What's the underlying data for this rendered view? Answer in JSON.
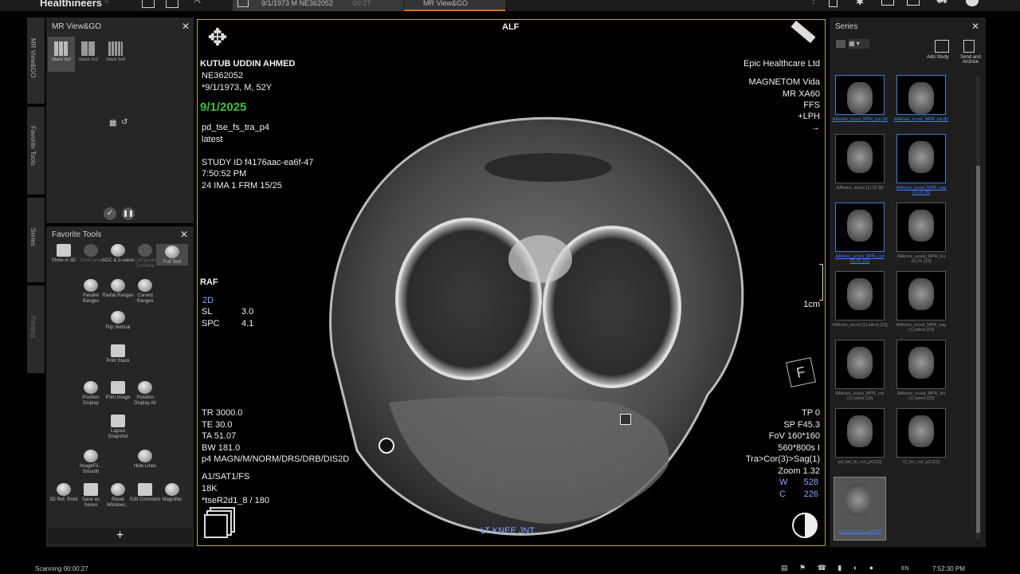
{
  "topbar": {
    "brand": "Healthineers",
    "tab1_label": "9/1/1973 M NE362052",
    "tab1_time": "00:27",
    "tab2_label": "MR View&GO"
  },
  "left_panel": {
    "title": "MR View&GO",
    "layouts": [
      "Stack 3x2",
      "Stack 2x2",
      "Stack 5x4"
    ]
  },
  "side_tabs": [
    "MR View&GO",
    "Favorite Tools",
    "Series",
    "Printing"
  ],
  "favorite_tools": {
    "title": "Favorite Tools",
    "tools": [
      {
        "id": "show3d",
        "label": "Show in 3D",
        "icon": "3d-icon"
      },
      {
        "id": "timecurve",
        "label": "TimeCurve",
        "icon": "timecurve-icon"
      },
      {
        "id": "adc",
        "label": "ADC & b-value",
        "icon": "adc-icon"
      },
      {
        "id": "compose",
        "label": "Compose/ Combine",
        "icon": "compose-icon"
      },
      {
        "id": "fulltext",
        "label": "Full Text",
        "icon": "fulltext-icon"
      },
      {
        "id": "parallel",
        "label": "Parallel Ranges",
        "icon": "parallel-ranges-icon"
      },
      {
        "id": "radial",
        "label": "Radial Ranges",
        "icon": "radial-ranges-icon"
      },
      {
        "id": "curved",
        "label": "Curved Ranges",
        "icon": "curved-ranges-icon"
      },
      {
        "id": "flip",
        "label": "Flip Vertical",
        "icon": "flip-vertical-icon"
      },
      {
        "id": "printstack",
        "label": "Print Stack",
        "icon": "print-stack-icon"
      },
      {
        "id": "posdisp",
        "label": "Position Display",
        "icon": "position-display-icon"
      },
      {
        "id": "printimg",
        "label": "Print Image",
        "icon": "print-image-icon"
      },
      {
        "id": "posdispall",
        "label": "Position Display All",
        "icon": "position-display-all-icon"
      },
      {
        "id": "layoutsnap",
        "label": "Layout Snapshot",
        "icon": "layout-snapshot-icon"
      },
      {
        "id": "imagefilter",
        "label": "ImageFil... Smooth",
        "icon": "image-filter-icon"
      },
      {
        "id": "hidelines",
        "label": "Hide Lines",
        "icon": "hide-lines-icon"
      },
      {
        "id": "ref3d",
        "label": "3D Ref. Point",
        "icon": "3d-ref-point-icon"
      },
      {
        "id": "saveseries",
        "label": "Save as Series",
        "icon": "save-series-icon"
      },
      {
        "id": "resetwin",
        "label": "Reset Windowi...",
        "icon": "reset-window-icon"
      },
      {
        "id": "editcomment",
        "label": "Edit Comment",
        "icon": "edit-comment-icon"
      },
      {
        "id": "magnifier",
        "label": "Magnifier",
        "icon": "magnifier-icon"
      }
    ]
  },
  "viewer": {
    "orient_top": "ALF",
    "orient_left": "RAF",
    "orient_bottom": "LT KNEE JNT.",
    "patient_name": "KUTUB UDDIN AHMED",
    "patient_id": "NE362052",
    "patient_dob": "*9/1/1973, M, 52Y",
    "study_date": "9/1/2025",
    "sequence": "pd_tse_fs_tra_p4",
    "sequence_sub": "latest",
    "study_id": "STUDY ID f4176aac-ea6f-47",
    "study_time": "7:50:52 PM",
    "image_info": "24 IMA 1 FRM 15/25",
    "mode": "2D",
    "sl_label": "SL",
    "sl_value": "3.0",
    "spc_label": "SPC",
    "spc_value": "4.1",
    "tr": "TR 3000.0",
    "te": "TE 30.0",
    "ta": "TA 51.07",
    "bw": "BW 181.0",
    "p4": "p4 MAGN/M/NORM/DRS/DRB/DIS2D",
    "coil": "A1/SAT1/FS",
    "k": "18K",
    "tser": "*tseR2d1_8 / 180",
    "institution": "Epic Healthcare Ltd",
    "scanner": "MAGNETOM Vida",
    "model": "MR XA60",
    "ffs": "FFS",
    "lph": "+LPH",
    "scale": "1cm",
    "tp": "TP 0",
    "sp": "SP F45.3",
    "fov": "FoV 160*160",
    "matrix": "560*800s I",
    "tra": "Tra>Cor(3)>Sag(1)",
    "zoom": "Zoom 1.32",
    "w_label": "W",
    "w_value": "528",
    "c_label": "C",
    "c_value": "226"
  },
  "series_panel": {
    "title": "Series",
    "add_study": "Add Study",
    "send_archive": "Send and Archive",
    "thumbnails": [
      {
        "caption": "AAknee_scout_MPR_cor [4]",
        "linked": true
      },
      {
        "caption": "AAknee_scout_MPR_tra [6]",
        "linked": true
      },
      {
        "caption": "AAknee_scout (1).01 [8]",
        "linked": false
      },
      {
        "caption": "AAknee_scout_MPR_sag (1).01 [9]",
        "linked": true
      },
      {
        "caption": "AAknee_scout_MPR_cor (1).01 [11]",
        "linked": true
      },
      {
        "caption": "AAknee_scout_MPR_tra (1).01 [13]",
        "linked": false
      },
      {
        "caption": "AAknee_scout (1).latest [15]",
        "linked": false
      },
      {
        "caption": "AAknee_scout_MPR_sag (1).latest [16]",
        "linked": false
      },
      {
        "caption": "AAknee_scout_MPR_cor (1).latest [18]",
        "linked": false
      },
      {
        "caption": "AAknee_scout_MPR_tra (1).latest [20]",
        "linked": false
      },
      {
        "caption": "pd_tse_fs_cor_p4 [22]",
        "linked": false
      },
      {
        "caption": "t1_tse_cor_p3 [23]",
        "linked": false
      },
      {
        "caption": "pd_tse_fs_tra_p4 [24]",
        "linked": true
      }
    ]
  },
  "statusbar": {
    "scanning": "Scanning 00:00:27",
    "lang": "EN",
    "clock": "7:52:30 PM"
  }
}
